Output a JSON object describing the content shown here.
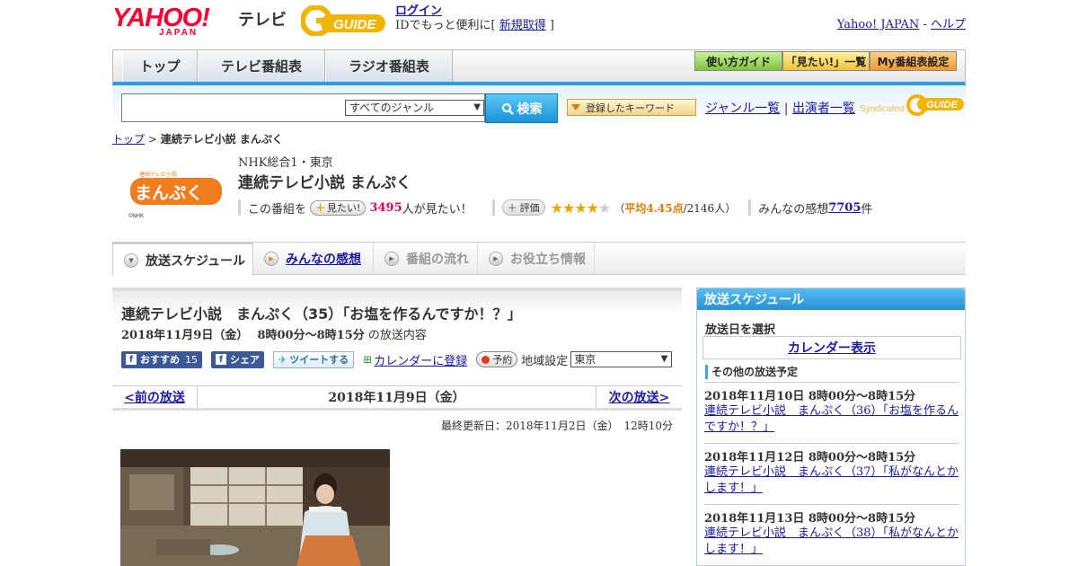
{
  "header": {
    "logo_text": "YAHOO!",
    "logo_sub": "JAPAN",
    "tv_label": "テレビ",
    "gguide_label": "GUIDE",
    "login_label": "ログイン",
    "login_desc_prefix": "IDでもっと便利に[ ",
    "register_label": "新規取得",
    "login_desc_suffix": " ]",
    "yahoo_japan_link": "Yahoo! JAPAN",
    "separator": " - ",
    "help_link": "ヘルプ"
  },
  "nav": {
    "tabs": [
      "トップ",
      "テレビ番組表",
      "ラジオ番組表"
    ],
    "buttons": [
      "使い方ガイド",
      "「見たい!」一覧",
      "My番組表設定"
    ]
  },
  "search": {
    "input_value": "",
    "genre_selected": "すべてのジャンル",
    "search_button": "検索",
    "keyword_button": "登録したキーワード",
    "genre_list_link": "ジャンル一覧",
    "divider": " | ",
    "performer_link": "出演者一覧",
    "syndicated_label": "Syndicated",
    "syndicated_brand": "GUIDE"
  },
  "breadcrumb": {
    "top_link": "トップ",
    "sep": " > ",
    "current": "連続テレビ小説 まんぷく"
  },
  "program": {
    "logo_text": "まんぷく",
    "logo_tagline": "連続テレビ小説",
    "logo_credit": "©NHK",
    "station": "NHK総合1・東京",
    "title": "連続テレビ小説 まんぷく",
    "want_prefix": "この番組を",
    "want_button": "見たい!",
    "want_count": "3495",
    "want_suffix": "人が見たい！",
    "rate_button": "評価",
    "rating": 4,
    "rating_max": 5,
    "rating_open": "（",
    "avg_label": "平均4.45点",
    "avg_suffix": "/2146人）",
    "impressions_prefix": "みんなの感想 ",
    "impressions_count": "7705",
    "impressions_suffix": "件"
  },
  "subtabs": [
    "放送スケジュール",
    "みんなの感想",
    "番組の流れ",
    "お役立ち情報"
  ],
  "episode": {
    "title": "連続テレビ小説　まんぷく（35）「お塩を作るんですか！？」",
    "date": "2018年11月9日（金）",
    "time": "8時00分～8時15分",
    "date_suffix": " の放送内容",
    "fb_label": "おすすめ",
    "fb_count": "15",
    "share_label": "シェア",
    "tweet_label": "ツイートする",
    "calendar_label": "カレンダーに登録",
    "reserve_label": "予約",
    "region_label": "地域設定",
    "region_value": "東京"
  },
  "pager": {
    "prev": "<前の放送",
    "current": "2018年11月9日（金）",
    "next": "次の放送>"
  },
  "updated": "最終更新日：2018年11月2日（金）　12時10分",
  "sidebar": {
    "title": "放送スケジュール",
    "select_date": "放送日を選択",
    "calendar_button": "カレンダー表示",
    "other_heading": "その他の放送予定",
    "schedule": [
      {
        "datetime": "2018年11月10日  8時00分～8時15分",
        "title": "連続テレビ小説　まんぷく（36）「お塩を作るんですか！？」"
      },
      {
        "datetime": "2018年11月12日  8時00分～8時15分",
        "title": "連続テレビ小説　まんぷく（37）「私がなんとかします！」"
      },
      {
        "datetime": "2018年11月13日  8時00分～8時15分",
        "title": "連続テレビ小説　まんぷく（38）「私がなんとかします！」"
      }
    ]
  },
  "colors": {
    "accent_blue": "#2b9ce6",
    "link": "#1a1aa6",
    "yahoo_red": "#ff0033",
    "manpuku_orange": "#f07d1e",
    "star": "#e6a600"
  }
}
